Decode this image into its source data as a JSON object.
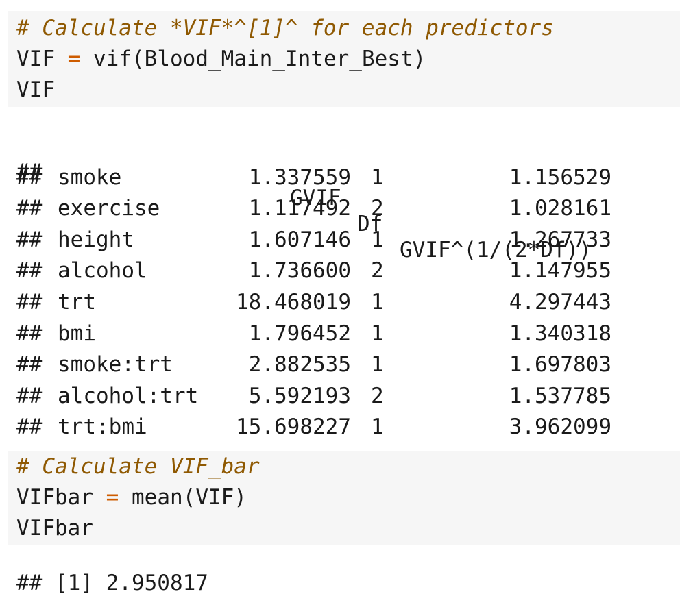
{
  "chunk1": {
    "comment": "# Calculate *VIF*^[1]^ for each predictors",
    "assign_lhs": "VIF",
    "assign_op": "=",
    "assign_rhs": "vif(Blood_Main_Inter_Best)",
    "print_var": "VIF"
  },
  "vif_output": {
    "prefix": "##",
    "headers": [
      "GVIF",
      "Df",
      "GVIF^(1/(2*Df))"
    ],
    "rows": [
      {
        "name": "smoke",
        "gvif": "1.337559",
        "df": "1",
        "adj": "1.156529"
      },
      {
        "name": "exercise",
        "gvif": "1.117492",
        "df": "2",
        "adj": "1.028161"
      },
      {
        "name": "height",
        "gvif": "1.607146",
        "df": "1",
        "adj": "1.267733"
      },
      {
        "name": "alcohol",
        "gvif": "1.736600",
        "df": "2",
        "adj": "1.147955"
      },
      {
        "name": "trt",
        "gvif": "18.468019",
        "df": "1",
        "adj": "4.297443"
      },
      {
        "name": "bmi",
        "gvif": "1.796452",
        "df": "1",
        "adj": "1.340318"
      },
      {
        "name": "smoke:trt",
        "gvif": "2.882535",
        "df": "1",
        "adj": "1.697803"
      },
      {
        "name": "alcohol:trt",
        "gvif": "5.592193",
        "df": "2",
        "adj": "1.537785"
      },
      {
        "name": "trt:bmi",
        "gvif": "15.698227",
        "df": "1",
        "adj": "3.962099"
      }
    ]
  },
  "chunk2": {
    "comment": "# Calculate VIF_bar",
    "assign_lhs": "VIFbar",
    "assign_op": "=",
    "assign_rhs": "mean(VIF)",
    "print_var": "VIFbar"
  },
  "vifbar_output": {
    "text": "## [1] 2.950817"
  },
  "colors": {
    "code_background": "#f6f6f6",
    "comment": "#8f5902",
    "operator": "#ce5c00",
    "text": "#1a1a1a"
  }
}
